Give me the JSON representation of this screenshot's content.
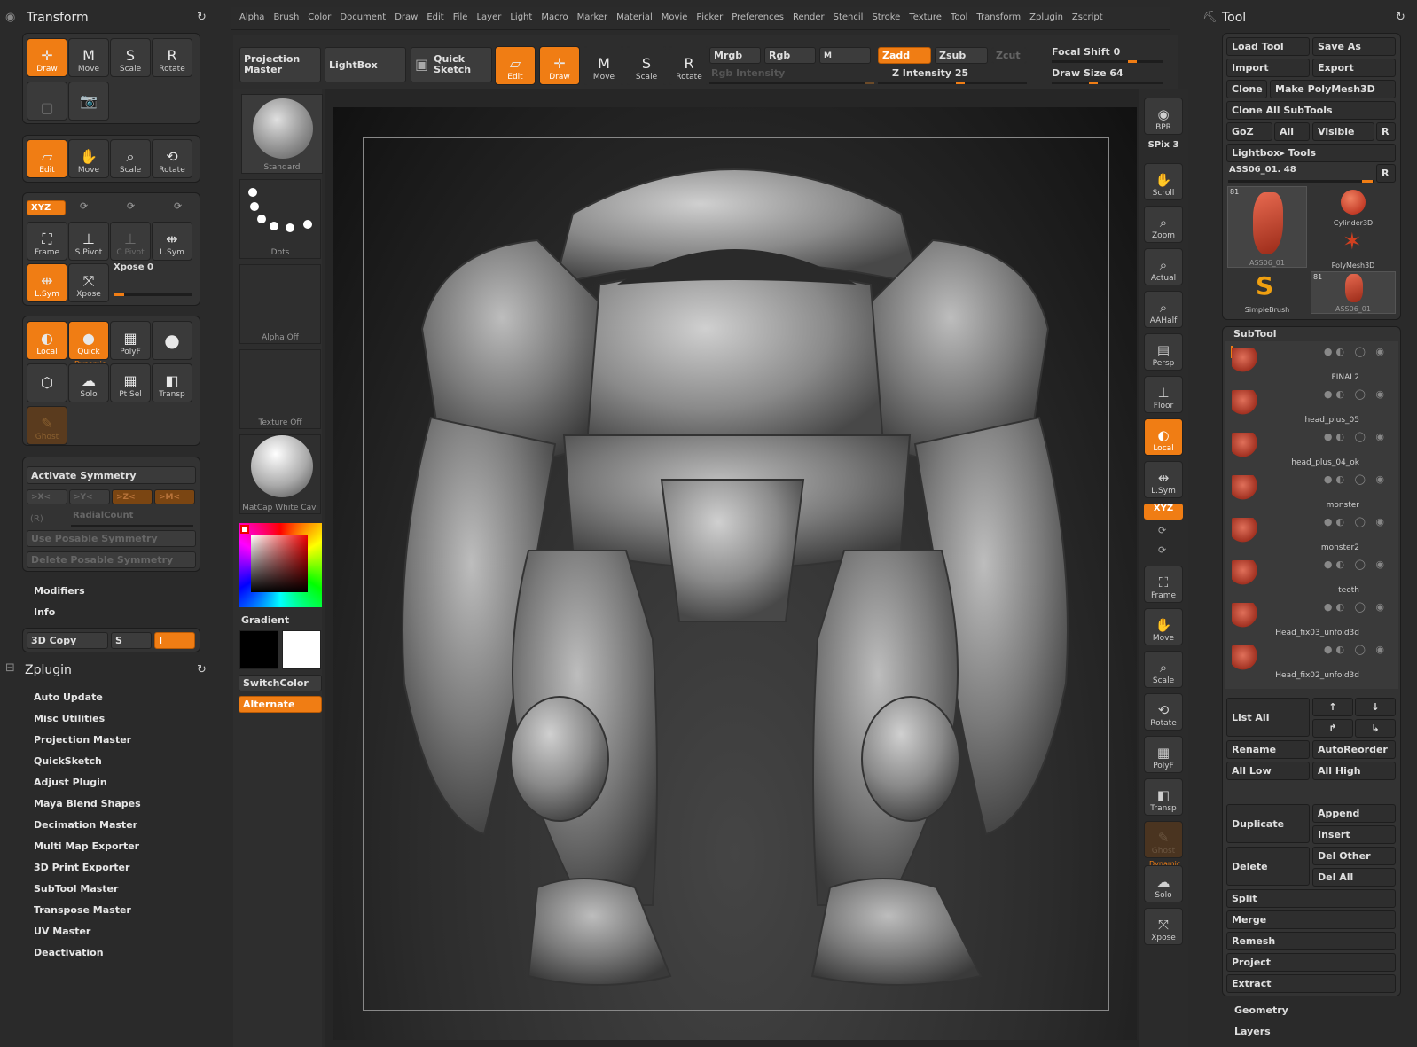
{
  "top_menu": [
    "Alpha",
    "Brush",
    "Color",
    "Document",
    "Draw",
    "Edit",
    "File",
    "Layer",
    "Light",
    "Macro",
    "Marker",
    "Material",
    "Movie",
    "Picker",
    "Preferences",
    "Render",
    "Stencil",
    "Stroke",
    "Texture",
    "Tool",
    "Transform",
    "Zplugin",
    "Zscript"
  ],
  "transform_panel": {
    "title": "Transform",
    "row1": [
      "Draw",
      "Move",
      "Scale",
      "Rotate"
    ],
    "row3": [
      "Edit",
      "Move",
      "Scale",
      "Rotate"
    ],
    "xyz_label": "XYZ",
    "row5": [
      "Frame",
      "S.Pivot",
      "C.Pivot",
      "L.Sym"
    ],
    "row6": [
      "L.Sym",
      "Xpose"
    ],
    "xpose_label": "Xpose 0",
    "row7": [
      "Local",
      "Quick",
      "PolyF",
      ""
    ],
    "row8": [
      "",
      "Solo",
      "Pt Sel",
      "Transp"
    ],
    "dynamic_label": "Dynamic",
    "ghost_label": "Ghost"
  },
  "symmetry_panel": {
    "activate": "Activate Symmetry",
    "axes": [
      ">X<",
      ">Y<",
      ">Z<",
      ">M<"
    ],
    "r_label": "(R)",
    "radial": "RadialCount",
    "use_posable": "Use Posable Symmetry",
    "delete_posable": "Delete Posable Symmetry"
  },
  "left_list": {
    "modifiers": "Modifiers",
    "info": "Info",
    "copy3d": "3D Copy",
    "s_label": "S",
    "i_label": "I"
  },
  "zplugin": {
    "title": "Zplugin",
    "items": [
      "Auto Update",
      "Misc Utilities",
      "Projection Master",
      "QuickSketch",
      "Adjust Plugin",
      "Maya Blend Shapes",
      "Decimation Master",
      "Multi Map Exporter",
      "3D Print Exporter",
      "SubTool Master",
      "Transpose Master",
      "UV Master",
      "Deactivation"
    ]
  },
  "brush_column": {
    "standard": "Standard",
    "dots": "Dots",
    "alpha": "Alpha  Off",
    "texture": "Texture  Off",
    "matcap": "MatCap  White  Cavi",
    "gradient": "Gradient",
    "switch_color": "SwitchColor",
    "alternate": "Alternate"
  },
  "toolbar": {
    "projection_master": "Projection Master",
    "lightbox": "LightBox",
    "quick_sketch": "Quick Sketch",
    "edit": "Edit",
    "draw": "Draw",
    "move": "Move",
    "scale": "Scale",
    "rotate": "Rotate",
    "mrgb": "Mrgb",
    "rgb": "Rgb",
    "m": "M",
    "zadd": "Zadd",
    "zsub": "Zsub",
    "zcut": "Zcut",
    "rgb_intensity": "Rgb  Intensity",
    "z_intensity": "Z Intensity 25",
    "focal_shift": "Focal Shift 0",
    "draw_size": "Draw Size 64"
  },
  "right_shelf": [
    "BPR",
    "SPix 3",
    "Scroll",
    "Zoom",
    "Actual",
    "AAHalf",
    "Persp",
    "Floor",
    "Local",
    "L.Sym",
    "XYZ",
    "Frame",
    "Move",
    "Scale",
    "Rotate",
    "PolyF",
    "Transp",
    "Ghost",
    "Solo",
    "Xpose"
  ],
  "right_shelf_dynamic": "Dynamic",
  "tool_panel": {
    "title": "Tool",
    "load_tool": "Load Tool",
    "save_as": "Save As",
    "import": "Import",
    "export": "Export",
    "clone": "Clone",
    "make_polymesh": "Make PolyMesh3D",
    "clone_all": "Clone  All  SubTools",
    "goz": "GoZ",
    "all": "All",
    "visible": "Visible",
    "r": "R",
    "lightbox_tools": "Lightbox▸ Tools",
    "current_tool": "ASS06_01. 48",
    "thumbs": [
      {
        "label": "ASS06_01",
        "count": "81"
      },
      {
        "label": "Cylinder3D"
      },
      {
        "label": "PolyMesh3D"
      },
      {
        "label": "SimpleBrush"
      },
      {
        "label": "ASS06_01",
        "count": "81"
      }
    ]
  },
  "subtool": {
    "title": "SubTool",
    "items": [
      "FINAL2",
      "head_plus_05",
      "head_plus_04_ok",
      "monster",
      "monster2",
      "teeth",
      "Head_fix03_unfold3d",
      "Head_fix02_unfold3d"
    ],
    "list_all": "List  All",
    "rename": "Rename",
    "autoreorder": "AutoReorder",
    "all_low": "All  Low",
    "all_high": "All  High",
    "duplicate": "Duplicate",
    "append": "Append",
    "insert": "Insert",
    "delete": "Delete",
    "del_other": "Del  Other",
    "del_all": "Del  All",
    "split": "Split",
    "merge": "Merge",
    "remesh": "Remesh",
    "project": "Project",
    "extract": "Extract",
    "geometry": "Geometry",
    "layers": "Layers"
  },
  "colors": {
    "accent": "#f07d14",
    "panel": "#333333",
    "background": "#2a2a2a"
  }
}
